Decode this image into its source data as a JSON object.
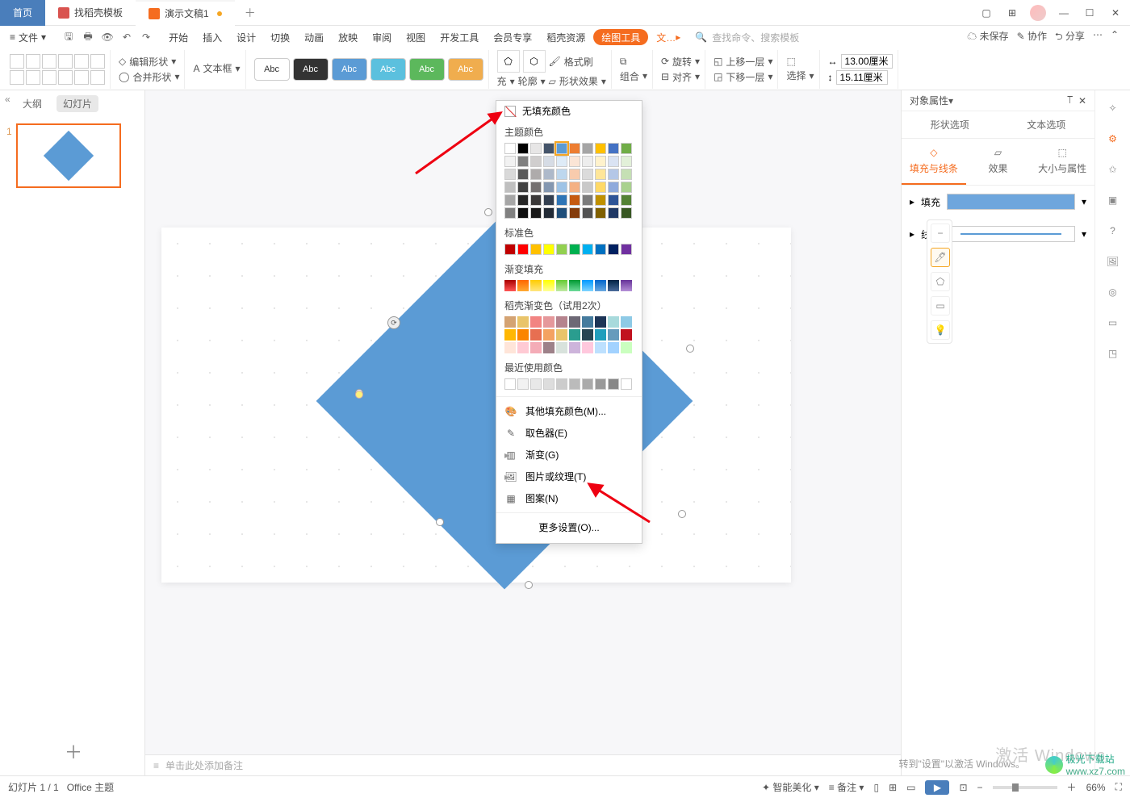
{
  "tabs": {
    "home": "首页",
    "templates": "找稻壳模板",
    "doc": "演示文稿1"
  },
  "menubar": {
    "file": "文件",
    "items": [
      "开始",
      "插入",
      "设计",
      "切换",
      "动画",
      "放映",
      "审阅",
      "视图",
      "开发工具",
      "会员专享",
      "稻壳资源"
    ],
    "drawingTools": "绘图工具",
    "textTrunc": "文…",
    "searchPlaceholder": "查找命令、搜索模板",
    "unsaved": "未保存",
    "collab": "协作",
    "share": "分享"
  },
  "toolbar": {
    "editShape": "编辑形状",
    "textbox": "文本框",
    "mergeShapes": "合并形状",
    "abc": "Abc",
    "fill": "充",
    "outline": "轮廓",
    "effects": "形状效果",
    "formatPainter": "格式刷",
    "group": "组合",
    "rotate": "旋转",
    "align": "对齐",
    "bringForward": "上移一层",
    "sendBackward": "下移一层",
    "select": "选择",
    "width": "13.00厘米",
    "height": "15.11厘米"
  },
  "leftpanel": {
    "outline": "大纲",
    "slides": "幻灯片",
    "num": "1"
  },
  "fillpopup": {
    "noFill": "无填充颜色",
    "themeColors": "主题颜色",
    "standardColors": "标准色",
    "gradientFill": "渐变填充",
    "dockGradient": "稻壳渐变色（试用2次）",
    "recentColors": "最近使用颜色",
    "moreFill": "其他填充颜色(M)...",
    "eyedropper": "取色器(E)",
    "gradient": "渐变(G)",
    "pictureTexture": "图片或纹理(T)",
    "pattern": "图案(N)",
    "moreSettings": "更多设置(O)..."
  },
  "rpanel": {
    "title": "对象属性",
    "shapeOptions": "形状选项",
    "textOptions": "文本选项",
    "fillLine": "填充与线条",
    "effects": "效果",
    "sizeProps": "大小与属性",
    "fill": "填充",
    "line": "线条"
  },
  "notes": "单击此处添加备注",
  "status": {
    "slide": "幻灯片 1 / 1",
    "theme": "Office 主题",
    "beautify": "智能美化",
    "notes": "备注",
    "zoom": "66%"
  },
  "watermark": "激活 Windows",
  "faint": "转到\"设置\"以激活 Windows。",
  "dlbadge": "极光下载站",
  "dlurl": "www.xz7.com"
}
